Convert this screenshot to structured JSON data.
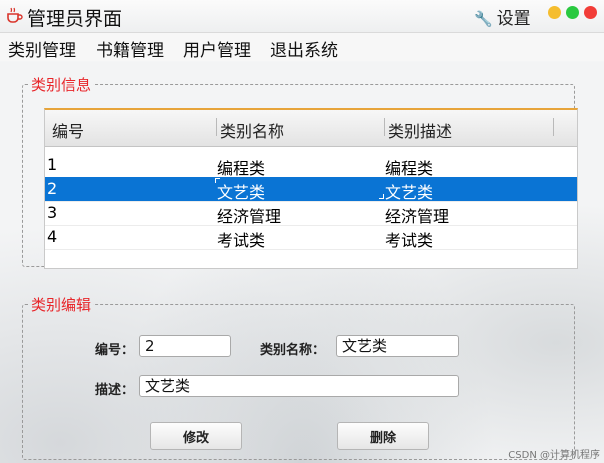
{
  "window": {
    "title": "管理员界面",
    "settings_label": "设置",
    "app_icon": "coffee-cup-icon",
    "settings_icon": "wrench-icon",
    "controls": {
      "minimize_color": "#f5bd2e",
      "maximize_color": "#2ac940",
      "close_color": "#f23d38"
    }
  },
  "menu": [
    "类别管理",
    "书籍管理",
    "用户管理",
    "退出系统"
  ],
  "info_panel": {
    "legend": "类别信息",
    "columns": [
      "编号",
      "类别名称",
      "类别描述"
    ],
    "rows": [
      [
        "1",
        "编程类",
        "编程类"
      ],
      [
        "2",
        "文艺类",
        "文艺类"
      ],
      [
        "3",
        "经济管理",
        "经济管理"
      ],
      [
        "4",
        "考试类",
        "考试类"
      ]
    ],
    "selected_row": 1,
    "selection_color": "#0a74d4"
  },
  "edit_panel": {
    "legend": "类别编辑",
    "id_label": "编号：",
    "id_value": "2",
    "name_label": "类别名称：",
    "name_value": "文艺类",
    "desc_label": "描述：",
    "desc_value": "文艺类",
    "modify_button": "修改",
    "delete_button": "删除"
  },
  "accent_color": "#e8262a",
  "watermark": "CSDN @计算机程序"
}
